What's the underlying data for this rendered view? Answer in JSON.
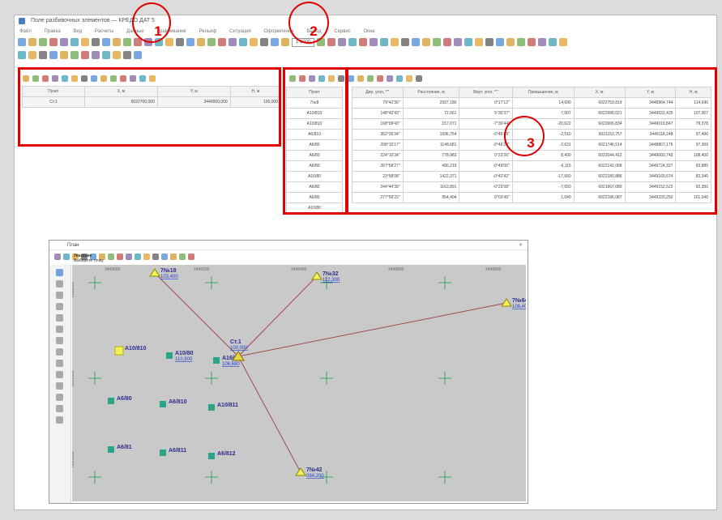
{
  "window": {
    "title": "Поле разбивочных элементов — КРЕДО ДАТ 5",
    "zoom_value": "1:1000"
  },
  "menu": {
    "items": [
      "Файл",
      "Правка",
      "Вид",
      "Расчеты",
      "Данные",
      "Уравнивание",
      "Рельеф",
      "Ситуация",
      "Оформление",
      "Вывод",
      "Сервис",
      "Окна"
    ]
  },
  "annotations": [
    {
      "id": "1",
      "label": "1"
    },
    {
      "id": "2",
      "label": "2"
    },
    {
      "id": "3",
      "label": "3"
    }
  ],
  "panel1": {
    "columns": [
      "Пункт",
      "Х, м",
      "Y, м",
      "H, м"
    ],
    "rows": [
      {
        "point": "Ст.1",
        "x": "6022700,000",
        "y": "3449000,000",
        "h": "100,000"
      }
    ]
  },
  "panel2": {
    "column": "Пункт",
    "rows": [
      "7№8",
      "А10/810",
      "А10/810",
      "А6/810",
      "А6/80",
      "А6/80",
      "А6/80",
      "А16/80",
      "А6/80",
      "А6/80",
      "А10/80"
    ]
  },
  "panel3": {
    "columns": [
      "Дир. угол, °'\"",
      "Расстояние, м",
      "Верт. угол, °'\"",
      "Превышение, м",
      "Х, м",
      "Y, м",
      "H, м"
    ],
    "rows": [
      [
        "79°42'30\"",
        "2937,180",
        "0°17'12\"",
        "14,690",
        "6022753,819",
        "3448964,744",
        "114,690"
      ],
      [
        "148°42'43\"",
        "72,661",
        "5°30'37\"",
        "7,007",
        "6022688,021",
        "3449022,425",
        "107,007"
      ],
      [
        "168°09'43\"",
        "157,071",
        "-7°30'44\"",
        "-20,622",
        "6022606,834",
        "3449019,847",
        "79,378"
      ],
      [
        "352°26'34\"",
        "1936,754",
        "-0°46'49\"",
        "-2,510",
        "6021153,757",
        "3449118,248",
        "97,490"
      ],
      [
        "208°15'17\"",
        "1148,681",
        "-0°46'23\"",
        "-2,631",
        "6021746,514",
        "3448807,176",
        "97,369"
      ],
      [
        "224°10'34\"",
        "778,983",
        "0°23'26\"",
        "8,400",
        "6022044,412",
        "3449660,749",
        "108,400"
      ],
      [
        "267°58'27\"",
        "490,219",
        "-0°49'00\"",
        "-6,115",
        "6022142,068",
        "3449724,327",
        "93,885"
      ],
      [
        "23°58'08\"",
        "1422,371",
        "-0°42'42\"",
        "-17,660",
        "6022180,886",
        "3449169,674",
        "82,340"
      ],
      [
        "244°44'39\"",
        "1163,891",
        "-0°23'08\"",
        "-7,650",
        "6021667,080",
        "3449152,522",
        "92,350"
      ],
      [
        "277°59'22\"",
        "954,404",
        "0°03'45\"",
        "1,040",
        "6022186,087",
        "3449320,250",
        "101,040"
      ]
    ]
  },
  "plan": {
    "title": "План",
    "zoom": "100%",
    "hint_title": "Указание",
    "hint_text": "Выберите точку",
    "scale_top": [
      "3449000",
      "3449200",
      "3449400",
      "3449600",
      "3449800"
    ],
    "scale_left": [
      "6022600",
      "6022400",
      "6022200"
    ],
    "points": [
      {
        "id": "7№18",
        "h": "103,400"
      },
      {
        "id": "7№32",
        "h": "112,300"
      },
      {
        "id": "7№64",
        "h": "108,400"
      },
      {
        "id": "А10/810",
        "h": ""
      },
      {
        "id": "А10/80",
        "h": "110,900"
      },
      {
        "id": "А16/80",
        "h": "106,680"
      },
      {
        "id": "А6/80",
        "h": ""
      },
      {
        "id": "А6/810",
        "h": ""
      },
      {
        "id": "А10/811",
        "h": ""
      },
      {
        "id": "А6/81",
        "h": ""
      },
      {
        "id": "А6/811",
        "h": ""
      },
      {
        "id": "А6/812",
        "h": ""
      },
      {
        "id": "7№42",
        "h": "084,200"
      }
    ],
    "station": {
      "id": "Ст.1",
      "h": "100,000"
    }
  },
  "colors": {
    "highlight": "#e00000",
    "point_yellow": "#f4f05a",
    "point_green": "#2aa58a",
    "line": "#a24b4b"
  }
}
